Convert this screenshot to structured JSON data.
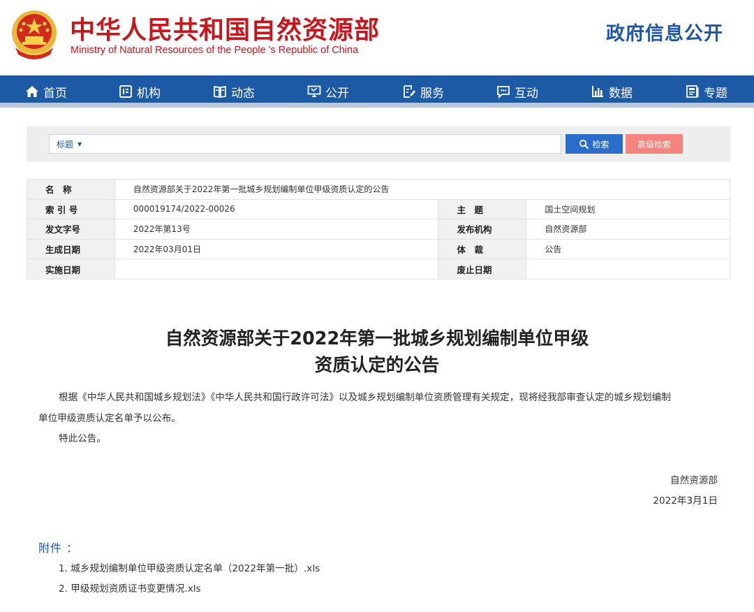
{
  "header": {
    "site_title": "中华人民共和国自然资源部",
    "site_subtitle": "Ministry of Natural Resources of the People 's Republic of China",
    "gov_open": "政府信息公开"
  },
  "nav": {
    "items": [
      {
        "label": "首页",
        "icon": "home-icon"
      },
      {
        "label": "机构",
        "icon": "org-icon"
      },
      {
        "label": "动态",
        "icon": "book-icon"
      },
      {
        "label": "公开",
        "icon": "monitor-icon"
      },
      {
        "label": "服务",
        "icon": "document-edit-icon"
      },
      {
        "label": "互动",
        "icon": "chat-icon"
      },
      {
        "label": "数据",
        "icon": "bar-chart-icon"
      },
      {
        "label": "专题",
        "icon": "topic-icon"
      }
    ],
    "colors": {
      "bar": "#1d5aa5",
      "stripe": "#b7c8de"
    }
  },
  "search": {
    "field_select": "标题",
    "input_value": "",
    "search_label": "检索",
    "advanced_label": "高级检索"
  },
  "info": {
    "name_label": "名　称",
    "name_value": "自然资源部关于2022年第一批城乡规划编制单位甲级资质认定的公告",
    "index_label": "索 引 号",
    "index_value": "000019174/2022-00026",
    "subject_label": "主　题",
    "subject_value": "国土空间规划",
    "docno_label": "发文字号",
    "docno_value": "2022年第13号",
    "publisher_label": "发布机构",
    "publisher_value": "自然资源部",
    "date_label": "生成日期",
    "date_value": "2022年03月01日",
    "genre_label": "体　裁",
    "genre_value": "公告",
    "effective_label": "实施日期",
    "effective_value": "",
    "repeal_label": "废止日期",
    "repeal_value": ""
  },
  "article": {
    "title_line1": "自然资源部关于2022年第一批城乡规划编制单位甲级",
    "title_line2": "资质认定的公告",
    "para1_line1": "根据《中华人民共和国城乡规划法》《中华人民共和国行政许可法》以及城乡规划编制单位资质管理有关规定，现将经我部审查认定的城乡规划编制",
    "para1_line2": "单位甲级资质认定名单予以公布。",
    "para2": "特此公告。",
    "signature": "自然资源部",
    "sign_date": "2022年3月1日"
  },
  "attachments": {
    "label": "附件 ：",
    "items": [
      "1. 城乡规划编制单位甲级资质认定名单（2022年第一批）.xls",
      "2. 甲级规划资质证书变更情况.xls"
    ]
  }
}
